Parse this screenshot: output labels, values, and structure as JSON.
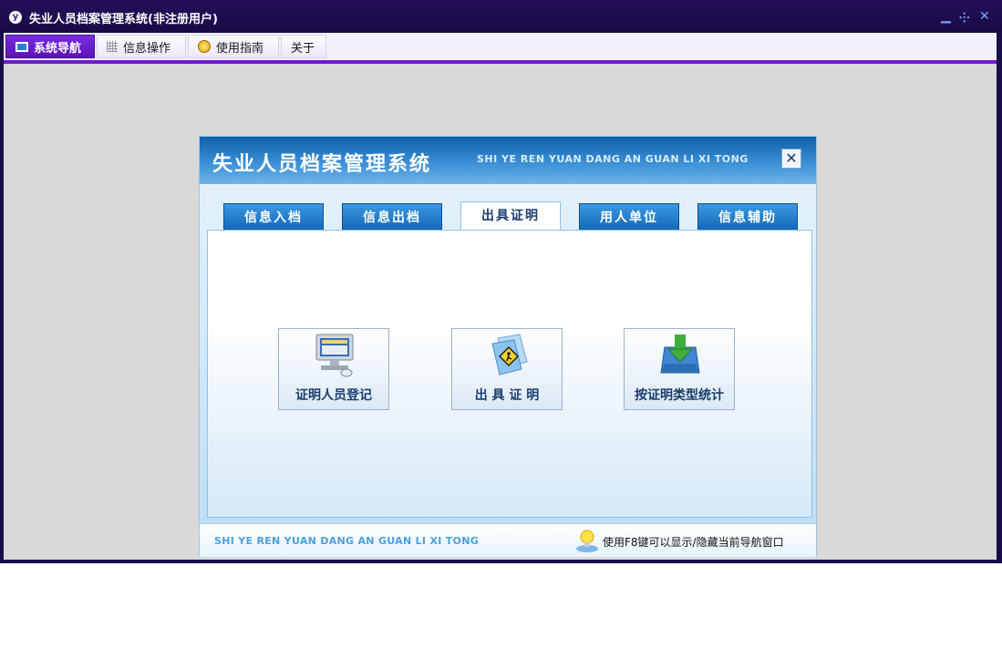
{
  "window": {
    "title": "失业人员档案管理系统(非注册用户)",
    "controls": {
      "minimize": "▁",
      "restore": "⸭",
      "close": "✕"
    }
  },
  "menu": [
    {
      "label": "系统导航",
      "icon": "monitor-icon",
      "active": true
    },
    {
      "label": "信息操作",
      "icon": "grid-icon",
      "active": false
    },
    {
      "label": "使用指南",
      "icon": "help-disc-icon",
      "active": false
    },
    {
      "label": "关于",
      "icon": "",
      "active": false
    }
  ],
  "dialog": {
    "title": "失业人员档案管理系统",
    "subtitle": "SHI YE REN YUAN DANG AN GUAN LI XI TONG",
    "close_label": "✕",
    "tabs": [
      {
        "label": "信息入档",
        "active": false
      },
      {
        "label": "信息出档",
        "active": false
      },
      {
        "label": "出具证明",
        "active": true
      },
      {
        "label": "用人单位",
        "active": false
      },
      {
        "label": "信息辅助",
        "active": false
      }
    ],
    "tiles": [
      {
        "label": "证明人员登记",
        "icon": "computer-icon"
      },
      {
        "label": "出 具 证 明",
        "icon": "document-caution-icon"
      },
      {
        "label": "按证明类型统计",
        "icon": "inbox-download-icon"
      }
    ],
    "footer": {
      "left": "SHI YE REN YUAN DANG AN GUAN LI XI TONG",
      "hint": "使用F8键可以显示/隐藏当前导航窗口",
      "hint_icon": "lightbulb-icon"
    }
  },
  "colors": {
    "titlebar": "#1b0d4a",
    "accent": "#6c1bd0",
    "tab_blue": "#1469b8",
    "canvas": "#d9d9d9"
  }
}
